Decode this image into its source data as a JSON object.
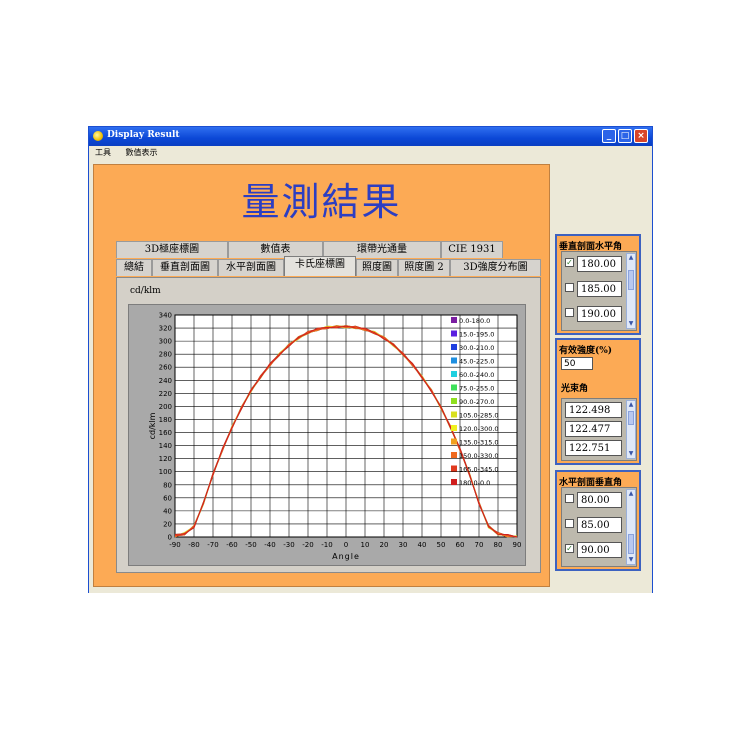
{
  "window": {
    "title": "Display Result",
    "menu": [
      "工具",
      "數值表示"
    ],
    "buttons": {
      "minimize": "_",
      "maximize": "□",
      "close": "×"
    }
  },
  "main": {
    "heading": "量測結果",
    "tabs_back": [
      "3D極座標圖",
      "數值表",
      "環帶光通量",
      "CIE 1931"
    ],
    "tabs_front": [
      "總結",
      "垂直剖面圖",
      "水平剖面圖",
      "卡氏座標圖",
      "照度圖",
      "照度圖 2",
      "3D強度分布圖"
    ],
    "active_tab": "卡氏座標圖"
  },
  "chart_data": {
    "type": "line",
    "unit_label": "cd/klm",
    "ylabel": "cd/klm",
    "xlabel": "Angle",
    "xlim": [
      -90,
      90
    ],
    "ylim": [
      0,
      340
    ],
    "xticks": [
      -90,
      -80,
      -70,
      -60,
      -50,
      -40,
      -30,
      -20,
      -10,
      0,
      10,
      20,
      30,
      40,
      50,
      60,
      70,
      80,
      90
    ],
    "yticks": [
      0,
      20,
      40,
      60,
      80,
      100,
      120,
      140,
      160,
      180,
      200,
      220,
      240,
      260,
      280,
      300,
      320,
      340
    ],
    "grid": true,
    "legend_position": "top-right",
    "x": [
      -90,
      -85,
      -80,
      -75,
      -70,
      -65,
      -60,
      -55,
      -50,
      -45,
      -40,
      -35,
      -30,
      -25,
      -20,
      -15,
      -10,
      -5,
      0,
      5,
      10,
      15,
      20,
      25,
      30,
      35,
      40,
      45,
      50,
      55,
      60,
      65,
      70,
      75,
      80,
      85,
      90
    ],
    "base_values": [
      2,
      5,
      16,
      52,
      96,
      134,
      168,
      198,
      224,
      245,
      264,
      280,
      294,
      305,
      313,
      318,
      321,
      322,
      322,
      321,
      318,
      313,
      305,
      294,
      280,
      264,
      245,
      224,
      198,
      168,
      134,
      96,
      52,
      16,
      5,
      2,
      0
    ],
    "series": [
      {
        "name": "0.0-180.0",
        "color": "#7b1fa2"
      },
      {
        "name": "15.0-195.0",
        "color": "#5a1fe0"
      },
      {
        "name": "30.0-210.0",
        "color": "#1f3fe0"
      },
      {
        "name": "45.0-225.0",
        "color": "#1f8fe0"
      },
      {
        "name": "60.0-240.0",
        "color": "#1fd0e0"
      },
      {
        "name": "75.0-255.0",
        "color": "#3ee05a"
      },
      {
        "name": "90.0-270.0",
        "color": "#8fe01f"
      },
      {
        "name": "105.0-285.0",
        "color": "#d8e01f"
      },
      {
        "name": "120.0-300.0",
        "color": "#f0f01f"
      },
      {
        "name": "135.0-315.0",
        "color": "#f0a01f"
      },
      {
        "name": "150.0-330.0",
        "color": "#f06a1f"
      },
      {
        "name": "165.0-345.0",
        "color": "#e03a1f"
      },
      {
        "name": "180.0-0.0",
        "color": "#d01f1f"
      }
    ]
  },
  "panels": {
    "vertical_section": {
      "title": "垂直剖面水平角",
      "items": [
        {
          "value": "180.00",
          "checked": true
        },
        {
          "value": "185.00",
          "checked": false
        },
        {
          "value": "190.00",
          "checked": false
        }
      ]
    },
    "effective": {
      "title": "有效強度(%)",
      "value": "50",
      "beam_title": "光束角",
      "beam_values": [
        "122.498",
        "122.477",
        "122.751"
      ]
    },
    "horizontal_section": {
      "title": "水平剖面垂直角",
      "items": [
        {
          "value": "80.00",
          "checked": false
        },
        {
          "value": "85.00",
          "checked": false
        },
        {
          "value": "90.00",
          "checked": true
        }
      ]
    }
  },
  "colors": {
    "panel_bg": "#fcaa55",
    "title_blue": "#2c3ec2",
    "frame_blue": "#3d62c0"
  }
}
